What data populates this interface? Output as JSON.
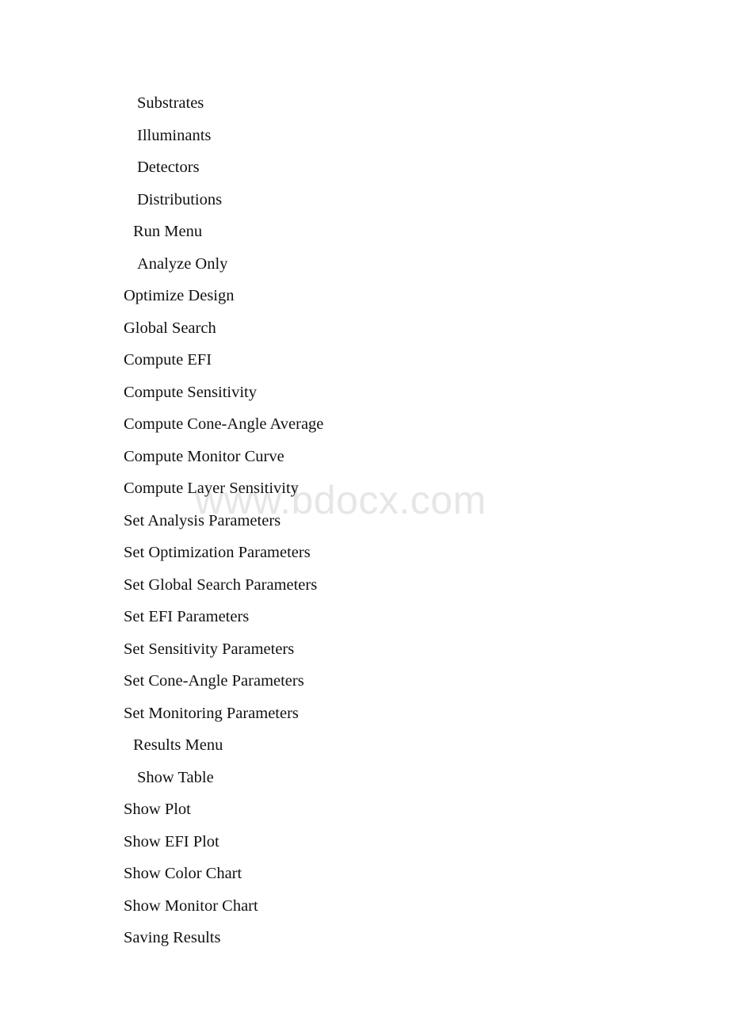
{
  "document": {
    "watermark": "www.bdocx.com",
    "watermark_color": "#e6e6e6",
    "text_color": "#111111",
    "background_color": "#ffffff"
  },
  "outline": {
    "items": [
      {
        "label": "Substrates",
        "level": 2
      },
      {
        "label": "Illuminants",
        "level": 2
      },
      {
        "label": "Detectors",
        "level": 2
      },
      {
        "label": "Distributions",
        "level": 2
      },
      {
        "label": "Run Menu",
        "level": 1
      },
      {
        "label": "Analyze Only",
        "level": 2
      },
      {
        "label": "Optimize Design",
        "level": 0
      },
      {
        "label": "Global Search",
        "level": 0
      },
      {
        "label": "Compute EFI",
        "level": 0
      },
      {
        "label": "Compute Sensitivity",
        "level": 0
      },
      {
        "label": "Compute Cone-Angle Average",
        "level": 0
      },
      {
        "label": "Compute Monitor Curve",
        "level": 0
      },
      {
        "label": "Compute Layer Sensitivity",
        "level": 0
      },
      {
        "label": "Set Analysis Parameters",
        "level": 0
      },
      {
        "label": "Set Optimization Parameters",
        "level": 0
      },
      {
        "label": "Set Global Search Parameters",
        "level": 0
      },
      {
        "label": "Set EFI Parameters",
        "level": 0
      },
      {
        "label": "Set Sensitivity Parameters",
        "level": 0
      },
      {
        "label": "Set Cone-Angle Parameters",
        "level": 0
      },
      {
        "label": "Set Monitoring Parameters",
        "level": 0
      },
      {
        "label": "Results Menu",
        "level": 1
      },
      {
        "label": "Show Table",
        "level": 2
      },
      {
        "label": "Show Plot",
        "level": 0
      },
      {
        "label": "Show EFI Plot",
        "level": 0
      },
      {
        "label": "Show Color Chart",
        "level": 0
      },
      {
        "label": "Show Monitor Chart",
        "level": 0
      },
      {
        "label": "Saving Results",
        "level": 0
      }
    ]
  }
}
